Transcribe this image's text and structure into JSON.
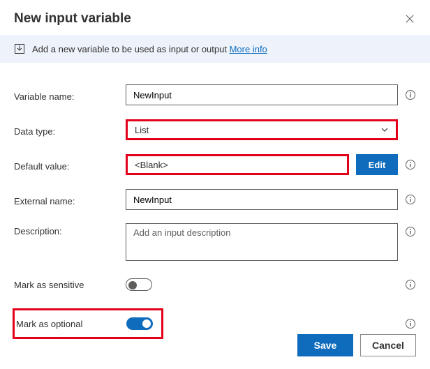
{
  "header": {
    "title": "New input variable"
  },
  "banner": {
    "text": "Add a new variable to be used as input or output ",
    "link": "More info"
  },
  "fields": {
    "variable_name": {
      "label": "Variable name:",
      "value": "NewInput"
    },
    "data_type": {
      "label": "Data type:",
      "value": "List"
    },
    "default_value": {
      "label": "Default value:",
      "value": "<Blank>",
      "edit": "Edit"
    },
    "external_name": {
      "label": "External name:",
      "value": "NewInput"
    },
    "description": {
      "label": "Description:",
      "placeholder": "Add an input description"
    },
    "sensitive": {
      "label": "Mark as sensitive",
      "on": false
    },
    "optional": {
      "label": "Mark as optional",
      "on": true
    }
  },
  "footer": {
    "save": "Save",
    "cancel": "Cancel"
  }
}
